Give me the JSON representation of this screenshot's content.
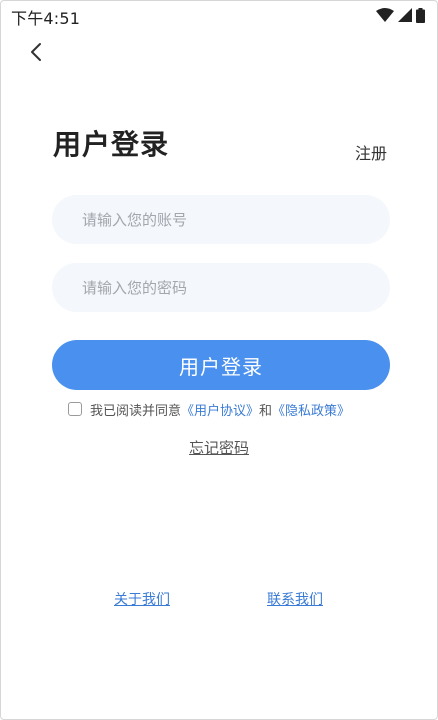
{
  "status_bar": {
    "time": "下午4:51",
    "icons": [
      "wifi-icon",
      "signal-icon",
      "battery-icon"
    ]
  },
  "header": {
    "back_icon": "chevron-left-icon",
    "title": "用户登录",
    "register_label": "注册"
  },
  "form": {
    "account_placeholder": "请输入您的账号",
    "account_value": "",
    "password_placeholder": "请输入您的密码",
    "password_value": "",
    "login_label": "用户登录",
    "agreement": {
      "checked": false,
      "prefix": "我已阅读并同意",
      "user_agreement": "《用户协议》",
      "and": "和",
      "privacy_policy": "《隐私政策》"
    },
    "forgot_password_label": "忘记密码"
  },
  "footer": {
    "about_label": "关于我们",
    "contact_label": "联系我们"
  },
  "colors": {
    "primary": "#4a90ee",
    "link": "#3a7bd5",
    "input_bg": "#f4f7fb"
  }
}
